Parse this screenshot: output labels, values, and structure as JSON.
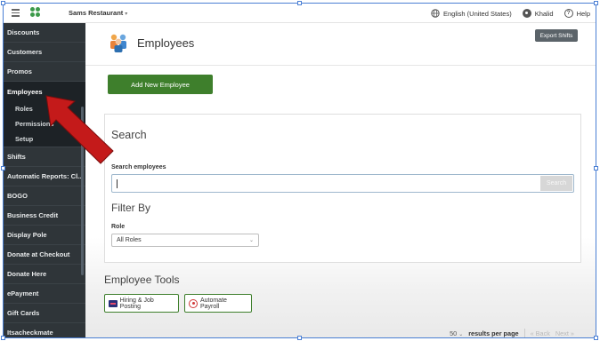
{
  "topbar": {
    "restaurant": "Sams Restaurant",
    "language": "English (United States)",
    "user": "Khalid",
    "help": "Help"
  },
  "sidebar": {
    "items": [
      {
        "label": "Discounts"
      },
      {
        "label": "Customers"
      },
      {
        "label": "Promos"
      },
      {
        "label": "Employees",
        "active": true,
        "sub": [
          {
            "label": "Roles"
          },
          {
            "label": "Permissions"
          },
          {
            "label": "Setup"
          }
        ]
      },
      {
        "label": "Shifts"
      },
      {
        "label": "Automatic Reports: Cl..."
      },
      {
        "label": "BOGO"
      },
      {
        "label": "Business Credit"
      },
      {
        "label": "Display Pole"
      },
      {
        "label": "Donate at Checkout"
      },
      {
        "label": "Donate Here"
      },
      {
        "label": "ePayment"
      },
      {
        "label": "Gift Cards"
      },
      {
        "label": "Itsacheckmate"
      }
    ]
  },
  "page": {
    "title": "Employees",
    "export_label": "Export Shifts",
    "add_label": "Add New Employee"
  },
  "search": {
    "heading": "Search",
    "field_label": "Search employees",
    "value": "",
    "button": "Search"
  },
  "filter": {
    "heading": "Filter By",
    "role_label": "Role",
    "role_value": "All Roles"
  },
  "tools": {
    "heading": "Employee Tools",
    "hiring": "Hiring & Job Posting",
    "payroll": "Automate Payroll"
  },
  "pager": {
    "per_page": "50",
    "per_page_label": "results per page",
    "back": "« Back",
    "next": "Next »"
  },
  "colors": {
    "sidebar_bg": "#2f3539",
    "primary_green": "#3e7f2c",
    "annotation_red": "#c41a1a"
  }
}
